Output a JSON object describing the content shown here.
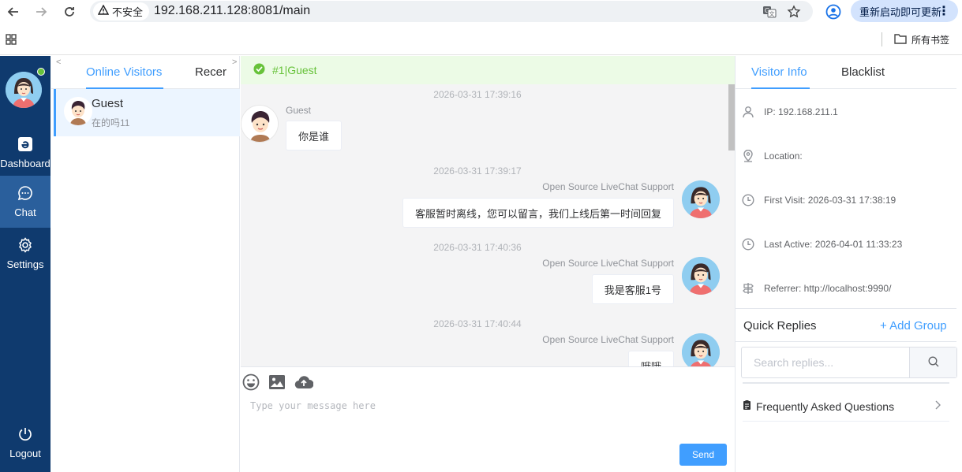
{
  "browser": {
    "insecure_label": "不安全",
    "url": "192.168.211.128:8081/main",
    "update_label": "重新启动即可更新",
    "bookmarks_all": "所有书签"
  },
  "sidenav": {
    "items": [
      {
        "label": "Dashboard"
      },
      {
        "label": "Chat"
      },
      {
        "label": "Settings"
      },
      {
        "label": "Logout"
      }
    ]
  },
  "visitors": {
    "tabs": [
      {
        "label": "Online Visitors"
      },
      {
        "label": "Recer"
      }
    ],
    "list": [
      {
        "name": "Guest",
        "last_message": "在的吗11"
      }
    ]
  },
  "chat": {
    "header_title": "#1|Guest",
    "messages": [
      {
        "time": "2026-03-31 17:39:16",
        "sender": "Guest",
        "text": "你是谁"
      },
      {
        "time": "2026-03-31 17:39:17",
        "sender": "Open Source LiveChat Support",
        "text": "客服暂时离线，您可以留言，我们上线后第一时间回复"
      },
      {
        "time": "2026-03-31 17:40:36",
        "sender": "Open Source LiveChat Support",
        "text": "我是客服1号"
      },
      {
        "time": "2026-03-31 17:40:44",
        "sender": "Open Source LiveChat Support",
        "text": "哦哦"
      }
    ],
    "input_placeholder": "Type your message here",
    "send_label": "Send"
  },
  "info": {
    "tabs": [
      {
        "label": "Visitor Info"
      },
      {
        "label": "Blacklist"
      }
    ],
    "ip": "IP: 192.168.211.1",
    "location": "Location:",
    "first_visit": "First Visit: 2026-03-31 17:38:19",
    "last_active": "Last Active: 2026-04-01 11:33:23",
    "referrer": "Referrer: http://localhost:9990/",
    "quick_replies_title": "Quick Replies",
    "add_group_label": "+ Add Group",
    "search_placeholder": "Search replies...",
    "faq_label": "Frequently Asked Questions"
  },
  "colors": {
    "sidebar_bg": "#0f3a6e",
    "sidebar_active": "#2a5f9c",
    "accent": "#409eff",
    "online": "#67c23a",
    "header_bg": "#ecfbe6"
  }
}
